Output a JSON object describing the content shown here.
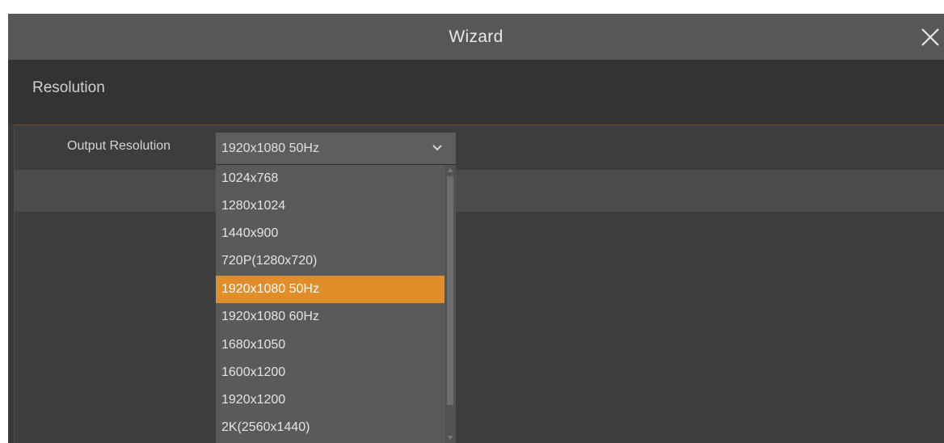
{
  "window": {
    "title": "Wizard"
  },
  "section": {
    "title": "Resolution"
  },
  "output_resolution": {
    "label": "Output Resolution",
    "selected_value": "1920x1080 50Hz",
    "options": [
      {
        "label": "1024x768",
        "selected": false
      },
      {
        "label": "1280x1024",
        "selected": false
      },
      {
        "label": "1440x900",
        "selected": false
      },
      {
        "label": "720P(1280x720)",
        "selected": false
      },
      {
        "label": "1920x1080 50Hz",
        "selected": true
      },
      {
        "label": "1920x1080 60Hz",
        "selected": false
      },
      {
        "label": "1680x1050",
        "selected": false
      },
      {
        "label": "1600x1200",
        "selected": false
      },
      {
        "label": "1920x1200",
        "selected": false
      },
      {
        "label": "2K(2560x1440)",
        "selected": false
      }
    ]
  },
  "icons": {
    "close": "close-icon",
    "dropdown": "chevron-down-icon",
    "scroll_up": "scroll-up-arrow-icon",
    "scroll_down": "scroll-down-arrow-icon"
  },
  "colors": {
    "accent": "#e08e2a",
    "titlebar": "#575757",
    "background": "#3a3a3a"
  }
}
